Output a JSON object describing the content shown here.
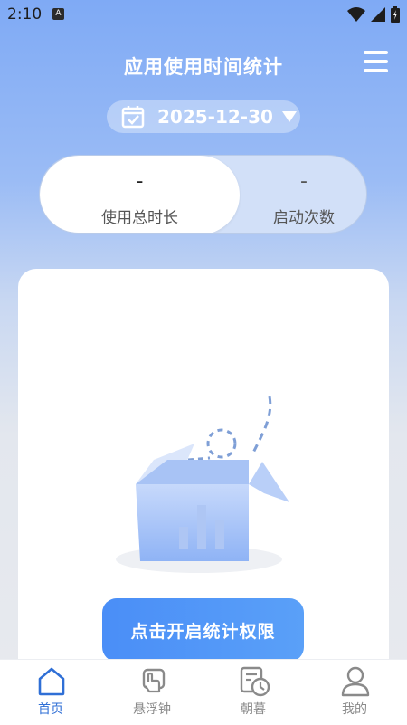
{
  "statusbar": {
    "time": "2:10",
    "notification_letter": "A"
  },
  "header": {
    "title": "应用使用时间统计"
  },
  "date_selector": {
    "date": "2025-12-30"
  },
  "stats_toggle": {
    "total_duration": {
      "value": "-",
      "label": "使用总时长"
    },
    "launch_count": {
      "value": "-",
      "label": "启动次数"
    },
    "selected": "total_duration"
  },
  "cta": {
    "label": "点击开启统计权限"
  },
  "tabbar": {
    "items": [
      {
        "label": "首页",
        "icon": "home-icon",
        "active": true
      },
      {
        "label": "悬浮钟",
        "icon": "floating-clock-icon",
        "active": false
      },
      {
        "label": "朝暮",
        "icon": "calendar-clock-icon",
        "active": false
      },
      {
        "label": "我的",
        "icon": "user-icon",
        "active": false
      }
    ]
  },
  "colors": {
    "accent": "#2f6fd6",
    "button": "#4a8ef7",
    "header_text": "#ffffff"
  }
}
